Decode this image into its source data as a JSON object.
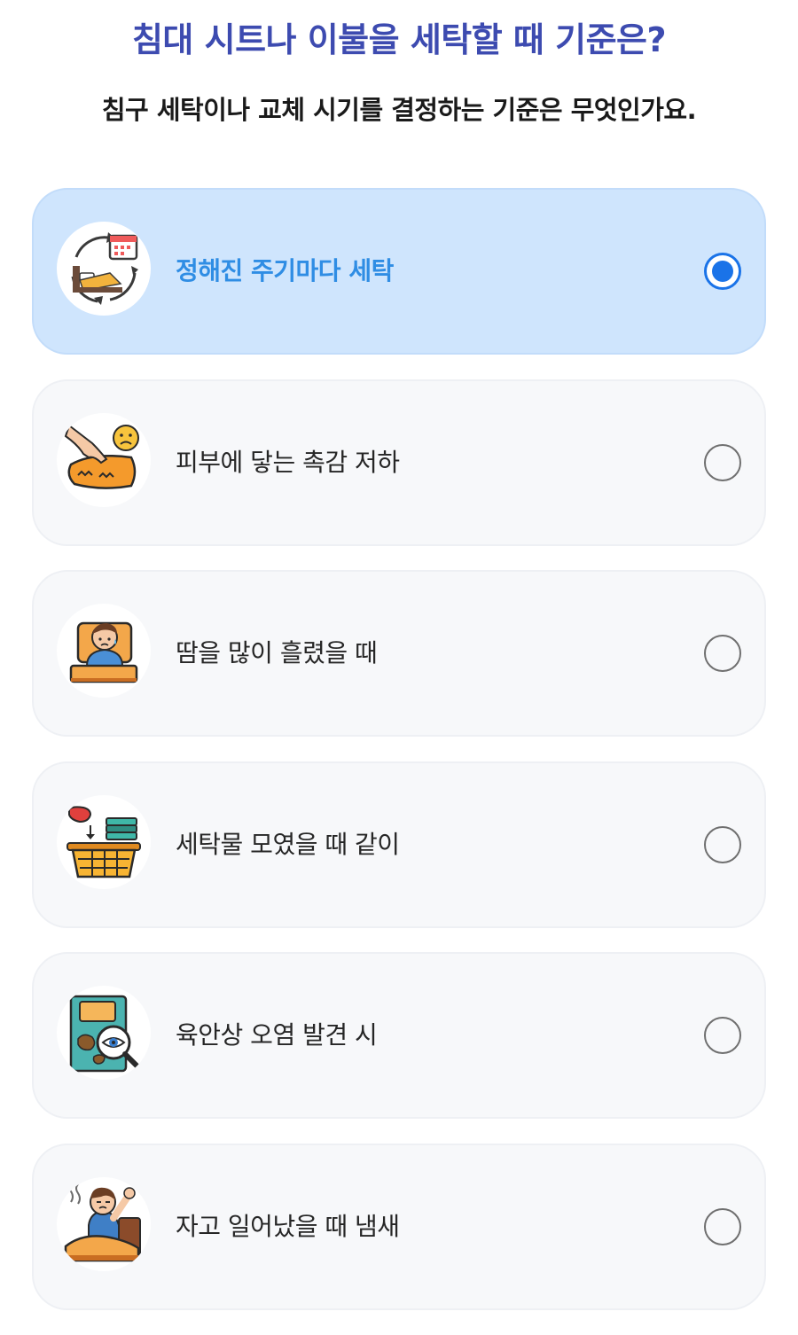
{
  "header": {
    "title": "침대 시트나 이불을 세탁할 때 기준은?",
    "subtitle": "침구 세탁이나 교체 시기를 결정하는 기준은 무엇인가요."
  },
  "options": [
    {
      "label": "정해진 주기마다 세탁",
      "icon": "laundry-cycle-calendar-icon",
      "selected": true
    },
    {
      "label": "피부에 닿는 촉감 저하",
      "icon": "hand-touching-bedding-icon",
      "selected": false
    },
    {
      "label": "땀을 많이 흘렸을 때",
      "icon": "sweating-person-in-bed-icon",
      "selected": false
    },
    {
      "label": "세탁물 모였을 때 같이",
      "icon": "laundry-basket-icon",
      "selected": false
    },
    {
      "label": "육안상 오염 발견 시",
      "icon": "stain-magnifier-icon",
      "selected": false
    },
    {
      "label": "자고 일어났을 때 냄새",
      "icon": "waking-up-smell-icon",
      "selected": false
    }
  ],
  "colors": {
    "title": "#3d4bb0",
    "selected_background": "#cfe5fd",
    "selected_label": "#2f8de4",
    "radio_selected": "#1a73e8",
    "card_background": "#f7f8fa"
  }
}
